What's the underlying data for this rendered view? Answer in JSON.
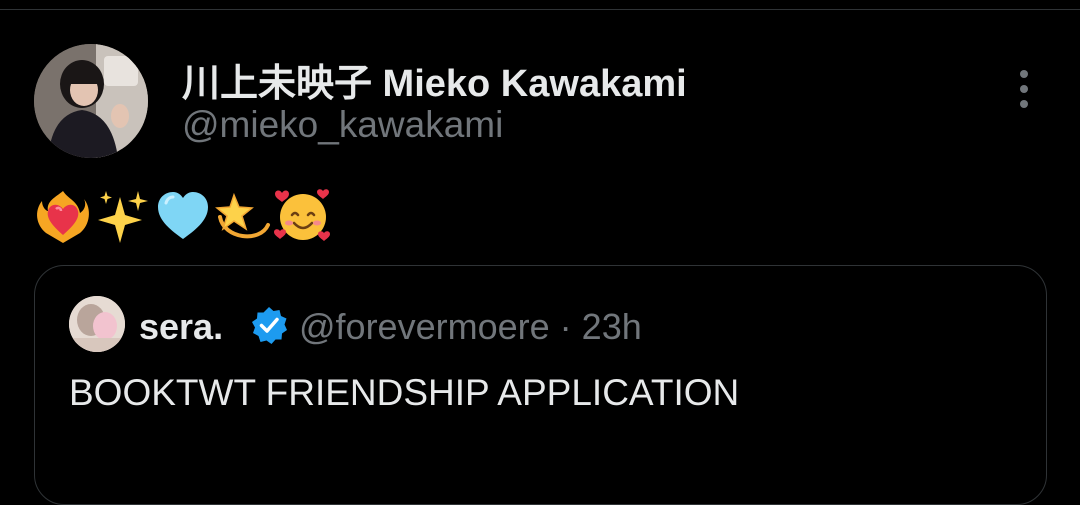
{
  "author": {
    "display_name": "川上未映子 Mieko Kawakami",
    "handle": "@mieko_kawakami",
    "avatar_icon": "profile-photo"
  },
  "tweet": {
    "emojis": [
      "heart-on-fire",
      "sparkles",
      "light-blue-heart",
      "dizzy",
      "smiling-face-with-hearts"
    ]
  },
  "quoted_tweet": {
    "display_name": "sera.",
    "verified": true,
    "handle": "@forevermoere",
    "separator": "·",
    "time": "23h",
    "text": "BOOKTWT FRIENDSHIP APPLICATION"
  },
  "colors": {
    "background": "#000000",
    "primary_text": "#e7e9ea",
    "secondary_text": "#71767b",
    "border": "#2f3336",
    "verified": "#1d9bf0"
  }
}
